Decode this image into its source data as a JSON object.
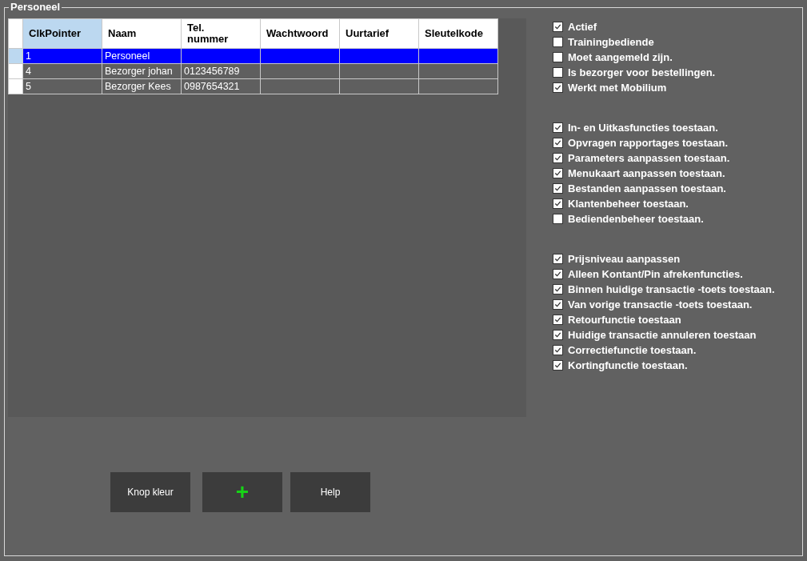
{
  "group_title": "Personeel",
  "table": {
    "columns": [
      {
        "label": "ClkPointer",
        "selected": true
      },
      {
        "label": "Naam",
        "selected": false
      },
      {
        "label": "Tel.\nnummer",
        "selected": false
      },
      {
        "label": "Wachtwoord",
        "selected": false
      },
      {
        "label": "Uurtarief",
        "selected": false
      },
      {
        "label": "Sleutelkode",
        "selected": false
      }
    ],
    "rows": [
      {
        "selected": true,
        "cells": [
          "1",
          "Personeel",
          "",
          "",
          "",
          ""
        ]
      },
      {
        "selected": false,
        "cells": [
          "4",
          "Bezorger johan",
          "0123456789",
          "",
          "",
          ""
        ]
      },
      {
        "selected": false,
        "cells": [
          "5",
          "Bezorger Kees",
          "0987654321",
          "",
          "",
          ""
        ]
      }
    ]
  },
  "option_groups": [
    [
      {
        "label": "Actief",
        "checked": true
      },
      {
        "label": "Trainingbediende",
        "checked": false
      },
      {
        "label": "Moet aangemeld zijn.",
        "checked": false
      },
      {
        "label": "Is bezorger voor bestellingen.",
        "checked": false
      },
      {
        "label": "Werkt met Mobilium",
        "checked": true
      }
    ],
    [
      {
        "label": "In- en Uitkasfuncties toestaan.",
        "checked": true
      },
      {
        "label": "Opvragen rapportages toestaan.",
        "checked": true
      },
      {
        "label": "Parameters aanpassen toestaan.",
        "checked": true
      },
      {
        "label": "Menukaart aanpassen toestaan.",
        "checked": true
      },
      {
        "label": "Bestanden aanpassen toestaan.",
        "checked": true
      },
      {
        "label": "Klantenbeheer  toestaan.",
        "checked": true
      },
      {
        "label": "Bediendenbeheer  toestaan.",
        "checked": false
      }
    ],
    [
      {
        "label": "Prijsniveau aanpassen",
        "checked": true
      },
      {
        "label": "Alleen Kontant/Pin afrekenfuncties.",
        "checked": true
      },
      {
        "label": "Binnen huidige transactie -toets toestaan.",
        "checked": true
      },
      {
        "label": "Van vorige transactie -toets toestaan.",
        "checked": true
      },
      {
        "label": "Retourfunctie toestaan",
        "checked": true
      },
      {
        "label": "Huidige transactie annuleren toestaan",
        "checked": true
      },
      {
        "label": "Correctiefunctie toestaan.",
        "checked": true
      },
      {
        "label": "Kortingfunctie toestaan.",
        "checked": true
      }
    ]
  ],
  "buttons": [
    {
      "kind": "text",
      "label": "Knop kleur"
    },
    {
      "kind": "add",
      "label": "+"
    },
    {
      "kind": "text",
      "label": "Help"
    }
  ]
}
